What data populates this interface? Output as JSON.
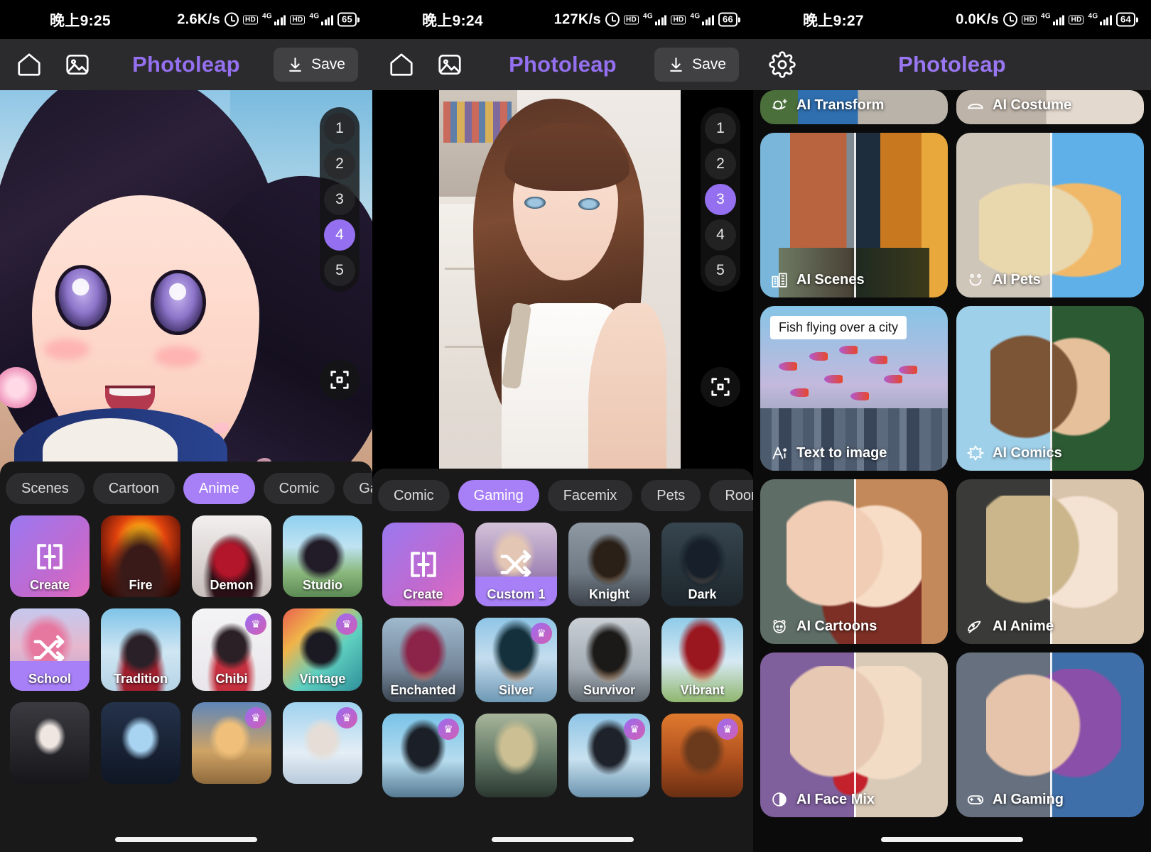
{
  "panels": [
    {
      "status": {
        "time": "晚上9:25",
        "speed": "2.6K/s",
        "battery": "65",
        "net1": "4G",
        "net2": "4G",
        "hd": "HD"
      },
      "header": {
        "brand": "Photoleap",
        "save_label": "Save",
        "icons": [
          "home-icon",
          "gallery-icon"
        ]
      },
      "versions": [
        "1",
        "2",
        "3",
        "4",
        "5"
      ],
      "active_version": "4",
      "categories": [
        {
          "label": "Scenes",
          "active": false
        },
        {
          "label": "Cartoon",
          "active": false
        },
        {
          "label": "Anime",
          "active": true
        },
        {
          "label": "Comic",
          "active": false
        },
        {
          "label": "Gaming",
          "active": false
        }
      ],
      "styles": [
        {
          "label": "Create",
          "kind": "create",
          "pro": false,
          "selected": false
        },
        {
          "label": "Fire",
          "kind": "photo",
          "pro": false,
          "selected": false
        },
        {
          "label": "Demon",
          "kind": "photo",
          "pro": false,
          "selected": false
        },
        {
          "label": "Studio",
          "kind": "photo",
          "pro": false,
          "selected": false
        },
        {
          "label": "School",
          "kind": "shuffle",
          "pro": false,
          "selected": true
        },
        {
          "label": "Tradition",
          "kind": "photo",
          "pro": false,
          "selected": false
        },
        {
          "label": "Chibi",
          "kind": "photo",
          "pro": true,
          "selected": false
        },
        {
          "label": "Vintage",
          "kind": "photo",
          "pro": true,
          "selected": false
        },
        {
          "label": "",
          "kind": "photo",
          "pro": false,
          "selected": false
        },
        {
          "label": "",
          "kind": "photo",
          "pro": false,
          "selected": false
        },
        {
          "label": "",
          "kind": "photo",
          "pro": true,
          "selected": false
        },
        {
          "label": "",
          "kind": "photo",
          "pro": true,
          "selected": false
        }
      ]
    },
    {
      "status": {
        "time": "晚上9:24",
        "speed": "127K/s",
        "battery": "66",
        "net1": "4G",
        "net2": "4G",
        "hd": "HD"
      },
      "header": {
        "brand": "Photoleap",
        "save_label": "Save",
        "icons": [
          "home-icon",
          "gallery-icon"
        ]
      },
      "versions": [
        "1",
        "2",
        "3",
        "4",
        "5"
      ],
      "active_version": "3",
      "categories": [
        {
          "label": "Comic",
          "active": false
        },
        {
          "label": "Gaming",
          "active": true
        },
        {
          "label": "Facemix",
          "active": false
        },
        {
          "label": "Pets",
          "active": false
        },
        {
          "label": "Rooms",
          "active": false
        }
      ],
      "styles": [
        {
          "label": "Create",
          "kind": "create",
          "pro": false,
          "selected": false
        },
        {
          "label": "Custom 1",
          "kind": "shuffle",
          "pro": false,
          "selected": true
        },
        {
          "label": "Knight",
          "kind": "photo",
          "pro": false,
          "selected": false
        },
        {
          "label": "Dark",
          "kind": "photo",
          "pro": false,
          "selected": false
        },
        {
          "label": "Enchanted",
          "kind": "photo",
          "pro": false,
          "selected": false
        },
        {
          "label": "Silver",
          "kind": "photo",
          "pro": true,
          "selected": false
        },
        {
          "label": "Survivor",
          "kind": "photo",
          "pro": false,
          "selected": false
        },
        {
          "label": "Vibrant",
          "kind": "photo",
          "pro": false,
          "selected": false
        },
        {
          "label": "",
          "kind": "photo",
          "pro": true,
          "selected": false
        },
        {
          "label": "",
          "kind": "photo",
          "pro": false,
          "selected": false
        },
        {
          "label": "",
          "kind": "photo",
          "pro": true,
          "selected": false
        },
        {
          "label": "",
          "kind": "photo",
          "pro": true,
          "selected": false
        }
      ]
    },
    {
      "status": {
        "time": "晚上9:27",
        "speed": "0.0K/s",
        "battery": "64",
        "net1": "4G",
        "net2": "4G",
        "hd": "HD"
      },
      "header": {
        "brand": "Photoleap",
        "icons": [
          "gear-icon"
        ]
      },
      "features": [
        {
          "label": "AI Transform",
          "icon": "sparkle-planet-icon",
          "clipped": true,
          "art": "art-transform",
          "split": false,
          "prompt": null
        },
        {
          "label": "AI Costume",
          "icon": "hanger-icon",
          "clipped": true,
          "art": "art-costume",
          "split": false,
          "prompt": null
        },
        {
          "label": "AI Scenes",
          "icon": "buildings-icon",
          "clipped": false,
          "art": "art-arc",
          "split": true,
          "prompt": null
        },
        {
          "label": "AI Pets",
          "icon": "paw-icon",
          "clipped": false,
          "art": "art-dog",
          "split": true,
          "prompt": null
        },
        {
          "label": "Text to image",
          "icon": "ai-text-icon",
          "clipped": false,
          "art": "art-city",
          "split": false,
          "prompt": "Fish flying over a city"
        },
        {
          "label": "AI Comics",
          "icon": "burst-icon",
          "clipped": false,
          "art": "art-elf",
          "split": true,
          "prompt": null
        },
        {
          "label": "AI Cartoons",
          "icon": "cartoon-face-icon",
          "clipped": false,
          "art": "art-cart",
          "split": true,
          "prompt": null
        },
        {
          "label": "AI Anime",
          "icon": "anime-icon",
          "clipped": false,
          "art": "art-anime",
          "split": true,
          "prompt": null
        },
        {
          "label": "AI Face Mix",
          "icon": "face-mix-icon",
          "clipped": false,
          "art": "art-face",
          "split": true,
          "prompt": null
        },
        {
          "label": "AI Gaming",
          "icon": "gamepad-icon",
          "clipped": false,
          "art": "art-game",
          "split": true,
          "prompt": null
        }
      ]
    }
  ],
  "colors": {
    "accent": "#9470f0",
    "accent_pill": "#a77ff7",
    "sheet_bg": "#191919",
    "appbar": "#2b2b2d"
  }
}
